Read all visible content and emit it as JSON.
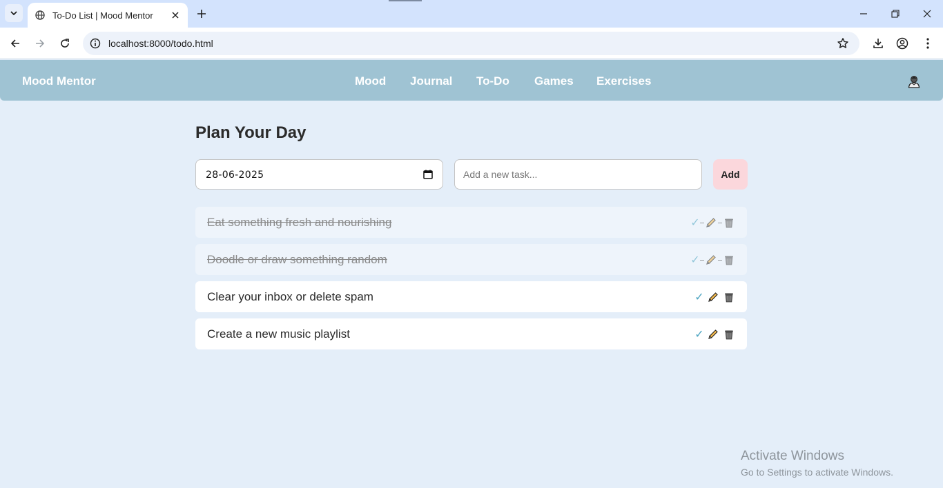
{
  "browser": {
    "tab_title": "To-Do List | Mood Mentor",
    "url": "localhost:8000/todo.html"
  },
  "nav": {
    "brand": "Mood Mentor",
    "links": [
      "Mood",
      "Journal",
      "To-Do",
      "Games",
      "Exercises"
    ]
  },
  "main": {
    "heading": "Plan Your Day",
    "date_value": "28-06-2025",
    "task_placeholder": "Add a new task...",
    "add_label": "Add",
    "tasks": [
      {
        "text": "Eat something fresh and nourishing",
        "done": true
      },
      {
        "text": "Doodle or draw something random",
        "done": true
      },
      {
        "text": "Clear your inbox or delete spam",
        "done": false
      },
      {
        "text": "Create a new music playlist",
        "done": false
      }
    ],
    "check_glyph": "✓"
  },
  "watermark": {
    "line1": "Activate Windows",
    "line2": "Go to Settings to activate Windows."
  },
  "colors": {
    "page_bg": "#e4eef9",
    "nav_bg": "#9fc3d3",
    "add_button_bg": "#fbd7dc",
    "check": "#4aa3c0"
  }
}
